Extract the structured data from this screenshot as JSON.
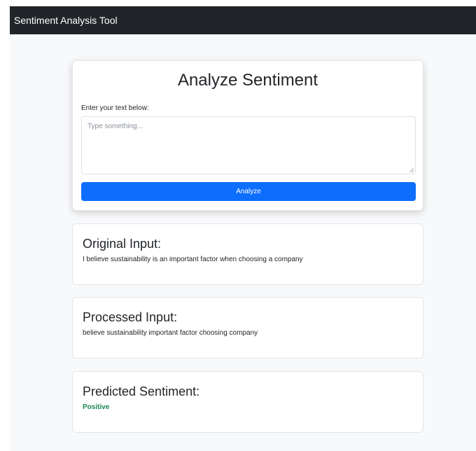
{
  "navbar": {
    "brand": "Sentiment Analysis Tool"
  },
  "analyze_card": {
    "title": "Analyze Sentiment",
    "label": "Enter your text below:",
    "textarea": {
      "value": "",
      "placeholder": "Type something..."
    },
    "button_label": "Analyze"
  },
  "results": {
    "original": {
      "title": "Original Input:",
      "text": "I believe sustainability is an important factor when choosing a company"
    },
    "processed": {
      "title": "Processed Input:",
      "text": "believe sustainability important factor choosing company"
    },
    "sentiment": {
      "title": "Predicted Sentiment:",
      "text": "Positive"
    }
  },
  "colors": {
    "navbar_bg": "#212529",
    "primary": "#0d6efd",
    "positive": "#198754",
    "page_bg": "#f8f9fa"
  }
}
